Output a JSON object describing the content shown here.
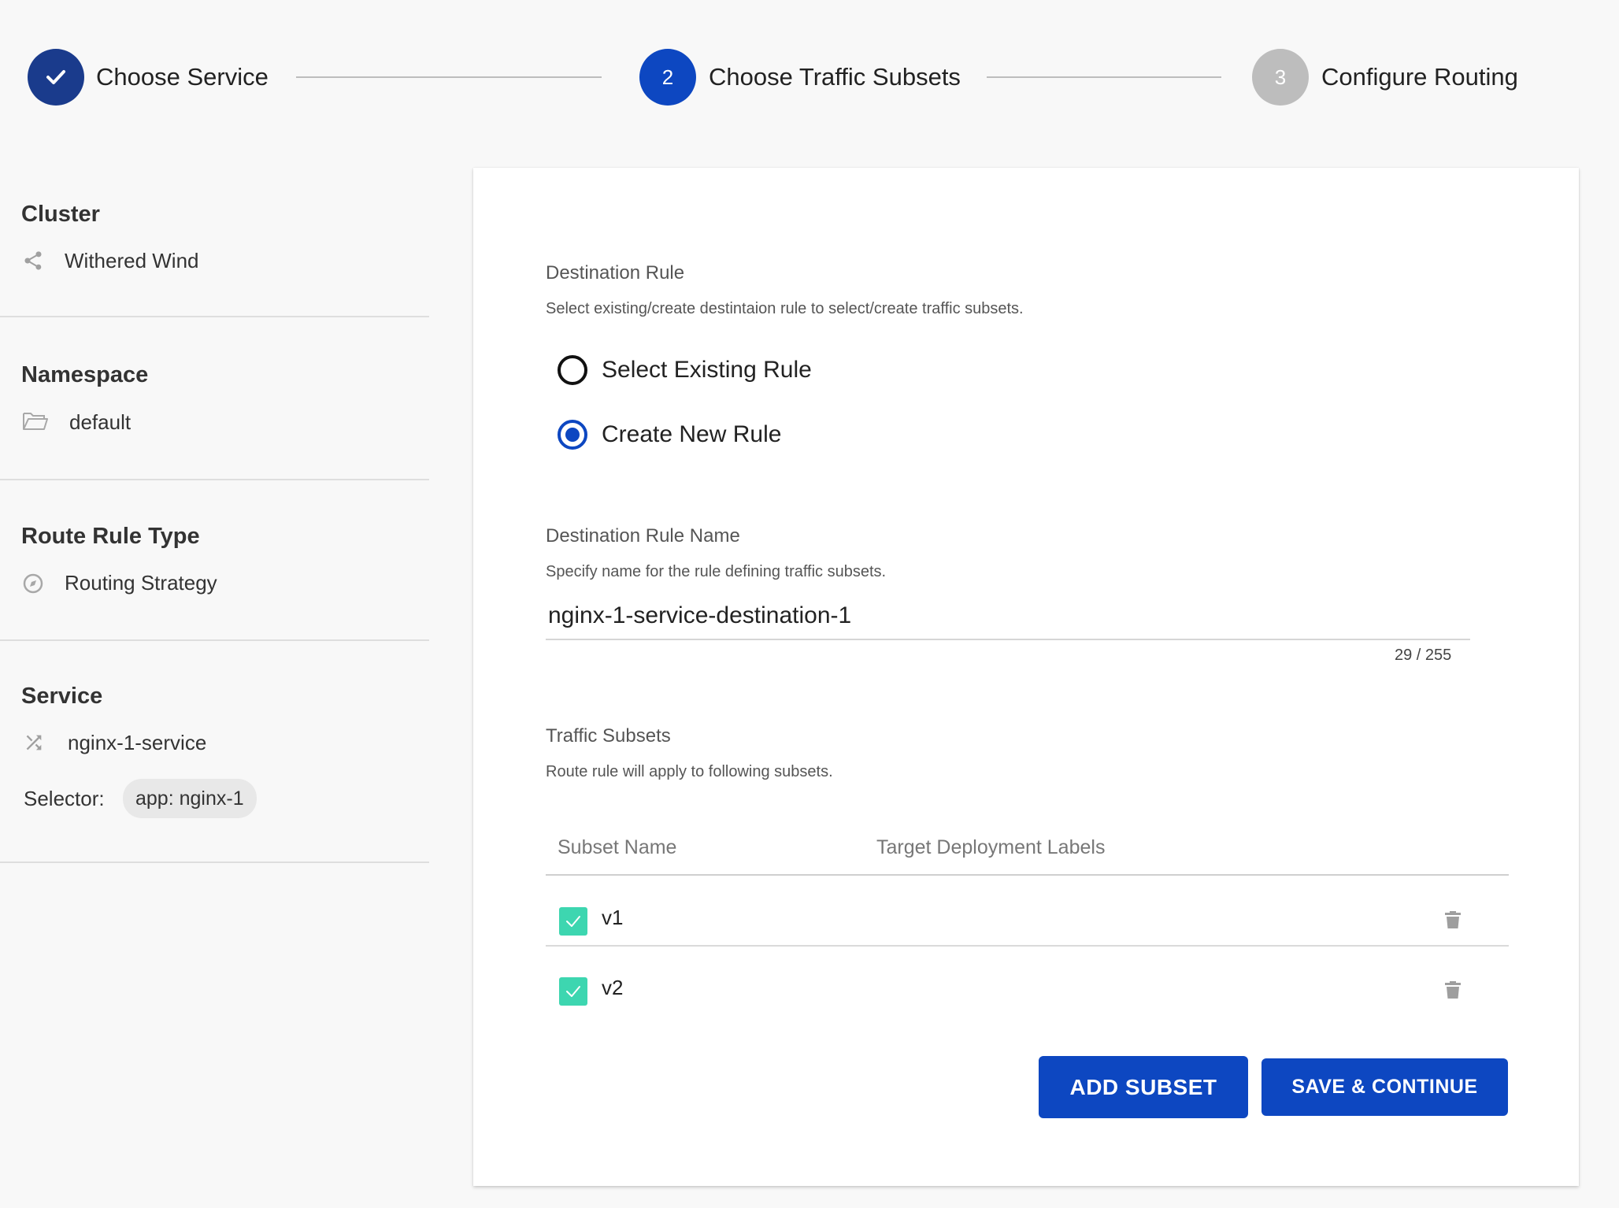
{
  "stepper": {
    "steps": [
      {
        "label": "Choose Service",
        "number": "",
        "status": "completed",
        "icon": "check-icon"
      },
      {
        "label": "Choose Traffic Subsets",
        "number": "2",
        "status": "active"
      },
      {
        "label": "Configure Routing",
        "number": "3",
        "status": "pending"
      }
    ]
  },
  "sidebar": {
    "cluster": {
      "title": "Cluster",
      "value": "Withered Wind",
      "icon": "share-icon"
    },
    "namespace": {
      "title": "Namespace",
      "value": "default",
      "icon": "folder-open-icon"
    },
    "route_rule_type": {
      "title": "Route Rule Type",
      "value": "Routing Strategy",
      "icon": "compass-icon"
    },
    "service": {
      "title": "Service",
      "value": "nginx-1-service",
      "icon": "shuffle-icon",
      "selector_label": "Selector:",
      "selector_chip": "app: nginx-1"
    }
  },
  "main": {
    "destination_rule": {
      "title": "Destination Rule",
      "description": "Select existing/create destintaion rule to select/create traffic subsets.",
      "options": [
        {
          "label": "Select Existing Rule",
          "selected": false
        },
        {
          "label": "Create New Rule",
          "selected": true
        }
      ]
    },
    "rule_name": {
      "title": "Destination Rule Name",
      "description": "Specify name for the rule defining traffic subsets.",
      "value": "nginx-1-service-destination-1",
      "counter": "29 / 255"
    },
    "subsets": {
      "title": "Traffic Subsets",
      "description": "Route rule will apply to following subsets.",
      "columns": [
        "Subset Name",
        "Target Deployment Labels"
      ],
      "rows": [
        {
          "name": "v1",
          "checked": true
        },
        {
          "name": "v2",
          "checked": true
        }
      ]
    },
    "buttons": {
      "add_subset": "ADD SUBSET",
      "save_continue": "SAVE & CONTINUE"
    }
  },
  "colors": {
    "primary": "#0d47c1",
    "completed": "#1a3b8c",
    "pending": "#bdbdbd",
    "checkbox": "#3dd6b0"
  }
}
